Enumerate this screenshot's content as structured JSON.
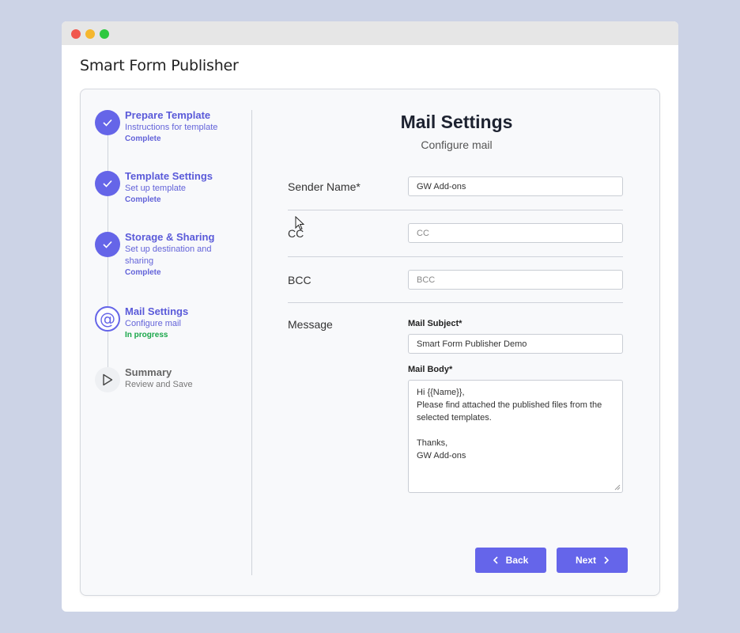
{
  "app": {
    "title": "Smart Form Publisher"
  },
  "steps": [
    {
      "title": "Prepare Template",
      "subtitle": "Instructions for template",
      "status": "Complete",
      "icon": "check-icon"
    },
    {
      "title": "Template Settings",
      "subtitle": "Set up template",
      "status": "Complete",
      "icon": "check-icon"
    },
    {
      "title": "Storage & Sharing",
      "subtitle": "Set up destination and sharing",
      "status": "Complete",
      "icon": "check-icon"
    },
    {
      "title": "Mail Settings",
      "subtitle": "Configure mail",
      "status": "In progress",
      "icon": "at-sign-icon"
    },
    {
      "title": "Summary",
      "subtitle": "Review and Save",
      "status": "",
      "icon": "play-icon"
    }
  ],
  "main": {
    "title": "Mail Settings",
    "subtitle": "Configure mail",
    "sender": {
      "label": "Sender Name*",
      "value": "GW Add-ons"
    },
    "cc": {
      "label": "CC",
      "placeholder": "CC"
    },
    "bcc": {
      "label": "BCC",
      "placeholder": "BCC"
    },
    "message": {
      "label": "Message",
      "subject_label": "Mail Subject*",
      "subject_value": "Smart Form Publisher Demo",
      "body_label": "Mail Body*",
      "body_lines": [
        "Hi {{Name}},",
        "Please find attached the published files from the",
        "selected templates.",
        "",
        "Thanks,",
        "GW Add-ons"
      ]
    }
  },
  "buttons": {
    "back": "Back",
    "next": "Next"
  },
  "colors": {
    "accent": "#6565e8",
    "success": "#1aa74a"
  }
}
